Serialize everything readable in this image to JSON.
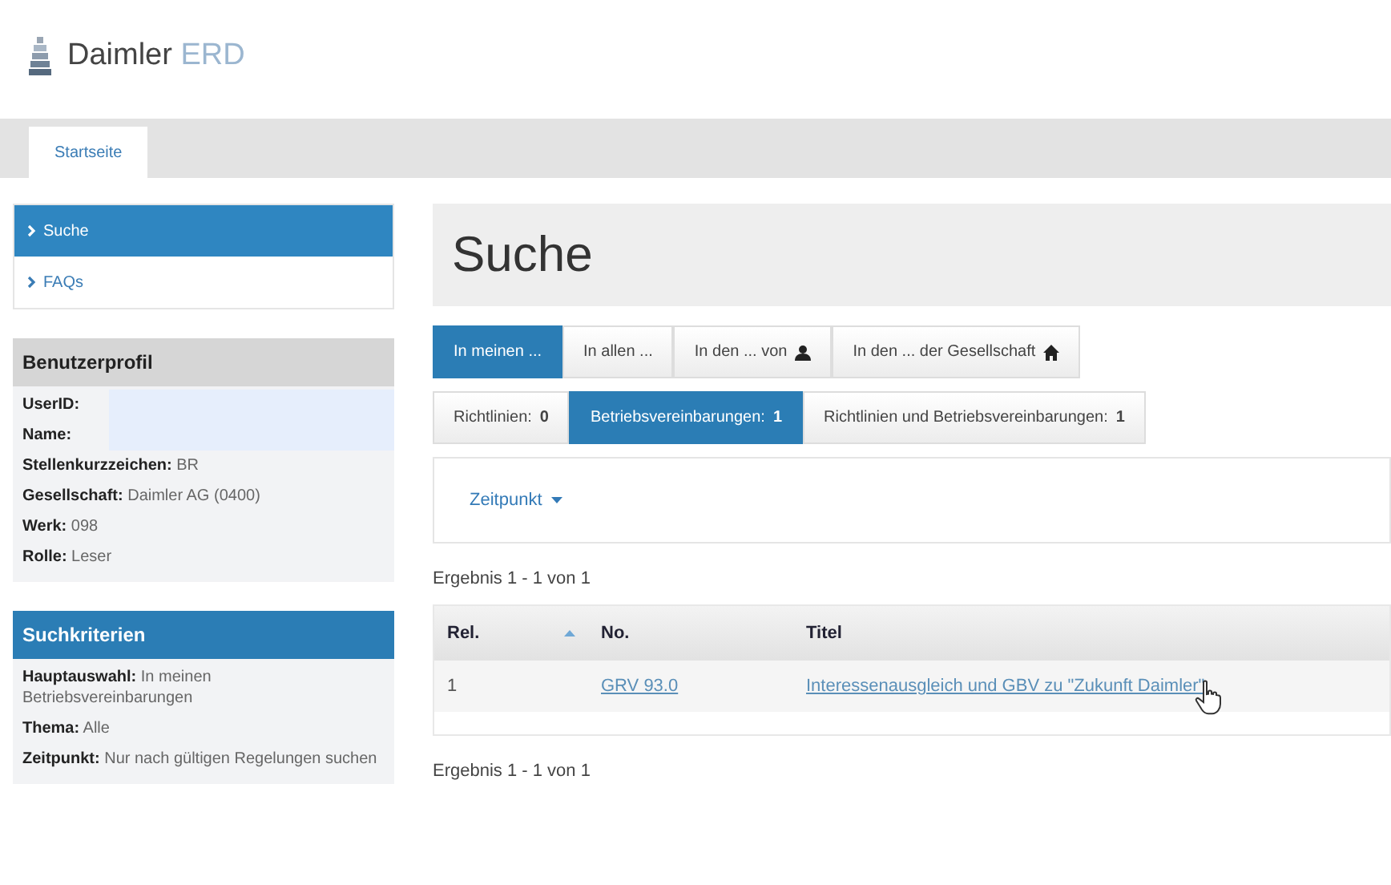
{
  "logo": {
    "brand": "Daimler",
    "product": "ERD"
  },
  "tabs": [
    {
      "label": "Startseite",
      "selected": true
    }
  ],
  "sidebar": {
    "nav": [
      {
        "label": "Suche",
        "selected": true
      },
      {
        "label": "FAQs",
        "selected": false
      }
    ],
    "profile": {
      "title": "Benutzerprofil",
      "items": [
        {
          "text": "**UserID:**",
          "highlighted": true
        },
        {
          "text": "**Name:**",
          "highlighted": true
        },
        {
          "text": "**Stellenkurzzeichen:** BR",
          "highlighted": false
        },
        {
          "text": "**Gesellschaft:** Daimler AG (0400)",
          "highlighted": false
        },
        {
          "text": "**Werk:** 098",
          "highlighted": false
        },
        {
          "text": "**Rolle:** Leser",
          "highlighted": false
        }
      ]
    },
    "criteria": {
      "title": "Suchkriterien",
      "items": [
        "**Hauptauswahl:** In meinen Betriebsvereinbarungen",
        "**Thema:** Alle",
        "**Zeitpunkt:** Nur nach gültigen Regelungen suchen"
      ]
    }
  },
  "main": {
    "heading": "Suche",
    "scope_buttons": [
      {
        "label": "In meinen ...",
        "selected": true
      },
      {
        "label": "In allen ...",
        "selected": false
      },
      {
        "label": "In den ... von",
        "selected": false,
        "kind": "user"
      },
      {
        "label": "In den ... der Gesellschaft",
        "selected": false,
        "kind": "home"
      }
    ],
    "type_buttons": [
      {
        "label": "Richtlinien: **0**",
        "selected": false
      },
      {
        "label": "Betriebsvereinbarungen: **1**",
        "selected": true
      },
      {
        "label": "Richtlinien und Betriebsvereinbarungen: **1**",
        "selected": false
      }
    ],
    "filter": {
      "label": "Zeitpunkt"
    },
    "result_top": "Ergebnis 1 - 1 von 1",
    "table": {
      "columns": [
        {
          "label": "Rel.",
          "sorted": true
        },
        {
          "label": "No.",
          "sorted": false
        },
        {
          "label": "Titel",
          "sorted": false
        }
      ],
      "rows": [
        {
          "rel": "1",
          "no": "GRV 93.0",
          "title": "Interessenausgleich und GBV zu \"Zukunft Daimler\""
        }
      ]
    },
    "result_bottom": "Ergebnis 1 - 1 von 1"
  }
}
